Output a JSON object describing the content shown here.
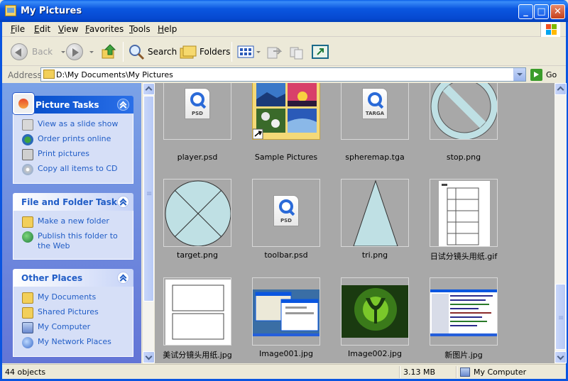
{
  "window": {
    "title": "My Pictures",
    "buttons": {
      "minimize": "_",
      "maximize": "□",
      "close": "✕"
    }
  },
  "menu": [
    "File",
    "Edit",
    "View",
    "Favorites",
    "Tools",
    "Help"
  ],
  "toolbar": {
    "back": "Back",
    "search": "Search",
    "folders": "Folders"
  },
  "address": {
    "label": "Address",
    "value": "D:\\My Documents\\My Pictures",
    "go": "Go"
  },
  "panels": {
    "picture_tasks": {
      "title": "Picture Tasks",
      "items": [
        "View as a slide show",
        "Order prints online",
        "Print pictures",
        "Copy all items to CD"
      ]
    },
    "file_tasks": {
      "title": "File and Folder Tasks",
      "items": [
        "Make a new folder",
        "Publish this folder to the Web"
      ]
    },
    "other_places": {
      "title": "Other Places",
      "items": [
        "My Documents",
        "Shared Pictures",
        "My Computer",
        "My Network Places"
      ]
    }
  },
  "files": [
    {
      "name": "player.psd",
      "kind": "psd",
      "label": "PSD"
    },
    {
      "name": "Sample Pictures",
      "kind": "folder"
    },
    {
      "name": "spheremap.tga",
      "kind": "tga",
      "label": "TARGA"
    },
    {
      "name": "stop.png",
      "kind": "stop"
    },
    {
      "name": "target.png",
      "kind": "target"
    },
    {
      "name": "toolbar.psd",
      "kind": "psd",
      "label": "PSD"
    },
    {
      "name": "tri.png",
      "kind": "tri"
    },
    {
      "name": "日试分镜头用纸.gif",
      "kind": "storyboard-gif"
    },
    {
      "name": "美试分镜头用纸.jpg",
      "kind": "storyboard-jpg"
    },
    {
      "name": "Image001.jpg",
      "kind": "screenshot1"
    },
    {
      "name": "Image002.jpg",
      "kind": "quake"
    },
    {
      "name": "新图片.jpg",
      "kind": "screenshot2"
    }
  ],
  "status": {
    "count": "44 objects",
    "size": "3.13 MB",
    "zone": "My Computer"
  },
  "colors": {
    "titlebar": "#0a56e0",
    "task_link": "#215dc6",
    "content_bg": "#a8a8a8",
    "shape_fill": "#bfe0e4"
  }
}
